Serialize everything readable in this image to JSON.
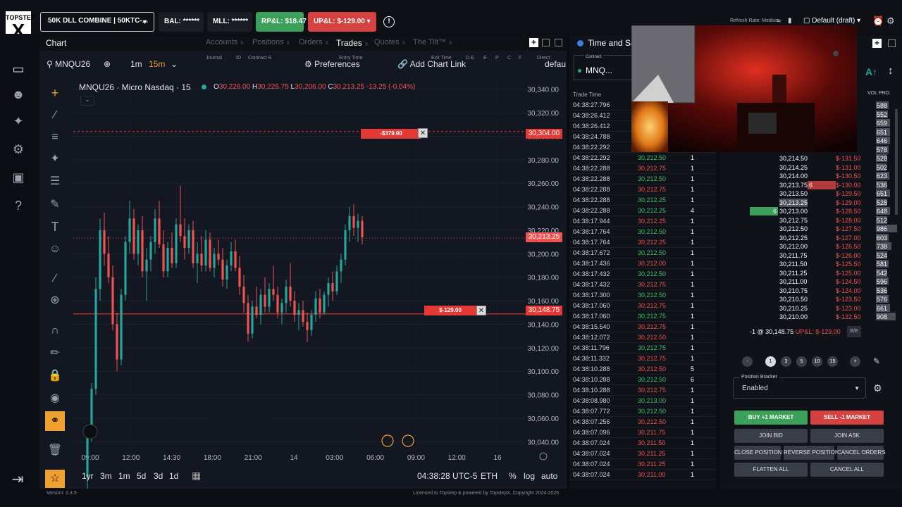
{
  "topbar": {
    "logo_line1": "TOPSTEP",
    "logo_line2": "X",
    "account": "50K DLL COMBINE  |  50KTC-...",
    "bal": "BAL: ******",
    "mll": "MLL: ******",
    "rpl": "RP&L: $18.47",
    "upl": "UP&L: $-129.00",
    "refresh": "Refresh Rate: Medium",
    "layout": "Default (draft)"
  },
  "panel_tabs": {
    "chart": "Chart",
    "accounts": "Accounts",
    "positions": "Positions",
    "orders": "Orders",
    "trades": "Trades",
    "quotes": "Quotes",
    "tilt": "The Tilt™"
  },
  "trades_headers": [
    "Journal",
    "ID",
    "Contract S",
    "Entry Time",
    "Exit Time",
    "D.E.",
    "E",
    "P",
    "C",
    "F",
    "Direct"
  ],
  "chart_toolbar": {
    "symbol": "MNQU26",
    "interval1": "1m",
    "interval2": "15m",
    "preferences": "Preferences",
    "add_link": "Add Chart Link",
    "default": "defau"
  },
  "chart_header": {
    "title": "MNQU26 · Micro Nasdaq · 15",
    "o": "30,226.00",
    "h": "30,226.75",
    "l": "30,206.00",
    "c": "30,213.25",
    "chg": "-13.25 (-0.04%)"
  },
  "chart_footer": {
    "ranges": [
      "1yr",
      "3m",
      "1m",
      "5d",
      "3d",
      "1d"
    ],
    "clock": "04:38:28 UTC-5",
    "session": "ETH",
    "pct": "%",
    "log": "log",
    "auto": "auto"
  },
  "orders_on_chart": {
    "upper_label": "-$379.00",
    "upper_price": "30,304.00",
    "lower_label": "$-129.00",
    "lower_price": "30,148.75",
    "last_price": "30,213.25"
  },
  "chart_data": {
    "type": "candlestick",
    "title": "MNQU26 · Micro Nasdaq · 15",
    "y_ticks": [
      30340,
      30320,
      30300,
      30280,
      30260,
      30240,
      30220,
      30200,
      30180,
      30160,
      30140,
      30120,
      30100,
      30080,
      30060,
      30040
    ],
    "y_tick_labels": [
      "30,340.00",
      "30,320.00",
      "30,300.00",
      "30,280.00",
      "30,260.00",
      "30,240.00",
      "30,220.00",
      "30,200.00",
      "30,180.00",
      "30,160.00",
      "30,140.00",
      "30,120.00",
      "30,100.00",
      "30,080.00",
      "30,060.00",
      "30,040.00"
    ],
    "ylim": [
      30030,
      30350
    ],
    "x_ticks": [
      "09:00",
      "12:00",
      "14:30",
      "18:00",
      "21:00",
      "14",
      "03:00",
      "06:00",
      "09:00",
      "12:00",
      "16"
    ],
    "candles": [
      [
        30010,
        30050,
        30000,
        30045
      ],
      [
        30045,
        30090,
        30040,
        30085
      ],
      [
        30085,
        30180,
        30080,
        30170
      ],
      [
        30170,
        30230,
        30160,
        30220
      ],
      [
        30220,
        30235,
        30190,
        30200
      ],
      [
        30200,
        30215,
        30175,
        30180
      ],
      [
        30180,
        30190,
        30135,
        30140
      ],
      [
        30140,
        30150,
        30100,
        30110
      ],
      [
        30110,
        30170,
        30105,
        30165
      ],
      [
        30165,
        30215,
        30160,
        30210
      ],
      [
        30210,
        30245,
        30200,
        30230
      ],
      [
        30230,
        30238,
        30195,
        30200
      ],
      [
        30200,
        30225,
        30190,
        30220
      ],
      [
        30220,
        30232,
        30180,
        30185
      ],
      [
        30185,
        30205,
        30160,
        30195
      ],
      [
        30195,
        30215,
        30185,
        30210
      ],
      [
        30210,
        30238,
        30200,
        30230
      ],
      [
        30230,
        30245,
        30205,
        30208
      ],
      [
        30208,
        30220,
        30180,
        30185
      ],
      [
        30185,
        30210,
        30180,
        30205
      ],
      [
        30205,
        30218,
        30188,
        30192
      ],
      [
        30192,
        30230,
        30188,
        30225
      ],
      [
        30225,
        30258,
        30210,
        30215
      ],
      [
        30215,
        30230,
        30195,
        30205
      ],
      [
        30205,
        30225,
        30200,
        30220
      ],
      [
        30220,
        30228,
        30188,
        30192
      ],
      [
        30192,
        30210,
        30175,
        30200
      ],
      [
        30200,
        30215,
        30185,
        30190
      ],
      [
        30190,
        30220,
        30185,
        30212
      ],
      [
        30212,
        30218,
        30185,
        30188
      ],
      [
        30188,
        30205,
        30180,
        30200
      ],
      [
        30200,
        30212,
        30190,
        30195
      ],
      [
        30195,
        30205,
        30172,
        30178
      ],
      [
        30178,
        30195,
        30170,
        30190
      ],
      [
        30190,
        30210,
        30185,
        30202
      ],
      [
        30202,
        30212,
        30185,
        30188
      ],
      [
        30188,
        30198,
        30165,
        30172
      ],
      [
        30172,
        30182,
        30150,
        30158
      ],
      [
        30158,
        30165,
        30125,
        30132
      ],
      [
        30132,
        30160,
        30128,
        30155
      ],
      [
        30155,
        30172,
        30145,
        30148
      ],
      [
        30148,
        30170,
        30140,
        30165
      ],
      [
        30165,
        30180,
        30150,
        30155
      ],
      [
        30155,
        30175,
        30150,
        30170
      ],
      [
        30170,
        30190,
        30160,
        30165
      ],
      [
        30165,
        30172,
        30145,
        30150
      ],
      [
        30150,
        30162,
        30140,
        30158
      ],
      [
        30158,
        30178,
        30150,
        30172
      ],
      [
        30172,
        30192,
        30155,
        30160
      ],
      [
        30160,
        30168,
        30142,
        30148
      ],
      [
        30148,
        30158,
        30135,
        30152
      ],
      [
        30152,
        30160,
        30138,
        30142
      ],
      [
        30142,
        30150,
        30125,
        30135
      ],
      [
        30135,
        30152,
        30130,
        30148
      ],
      [
        30148,
        30168,
        30142,
        30162
      ],
      [
        30162,
        30170,
        30145,
        30150
      ],
      [
        30150,
        30168,
        30148,
        30165
      ],
      [
        30165,
        30180,
        30155,
        30175
      ],
      [
        30175,
        30185,
        30160,
        30168
      ],
      [
        30168,
        30190,
        30165,
        30185
      ],
      [
        30185,
        30200,
        30175,
        30195
      ],
      [
        30195,
        30225,
        30190,
        30220
      ],
      [
        30220,
        30240,
        30210,
        30232
      ],
      [
        30232,
        30242,
        30215,
        30222
      ],
      [
        30222,
        30234,
        30210,
        30228
      ],
      [
        30228,
        30232,
        30208,
        30214
      ]
    ]
  },
  "time_sales": {
    "title": "Time and Sales",
    "contract_label": "Contract",
    "contract": "MNQ...",
    "header": "Trade Time",
    "rows": [
      [
        "04:38:27.796",
        "",
        "",
        ""
      ],
      [
        "04:38:26.412",
        "",
        "",
        ""
      ],
      [
        "04:38:26.412",
        "",
        "",
        ""
      ],
      [
        "04:38:24.788",
        "",
        "",
        ""
      ],
      [
        "04:38:22.292",
        "",
        "",
        ""
      ],
      [
        "04:38:22.292",
        "30,212.50",
        "g",
        "1"
      ],
      [
        "04:38:22.288",
        "30,212.75",
        "r",
        "1"
      ],
      [
        "04:38:22.288",
        "30,212.50",
        "g",
        "1"
      ],
      [
        "04:38:22.288",
        "30,212.75",
        "r",
        "1"
      ],
      [
        "04:38:22.288",
        "30,212.25",
        "g",
        "1"
      ],
      [
        "04:38:22.288",
        "30,212.25",
        "g",
        "4"
      ],
      [
        "04:38:17.944",
        "30,212.25",
        "r",
        "1"
      ],
      [
        "04:38:17.764",
        "30,212.50",
        "g",
        "1"
      ],
      [
        "04:38:17.764",
        "30,212.25",
        "r",
        "1"
      ],
      [
        "04:38:17.672",
        "30,212.50",
        "g",
        "1"
      ],
      [
        "04:38:17.436",
        "30,212.00",
        "r",
        "1"
      ],
      [
        "04:38:17.432",
        "30,212.50",
        "g",
        "1"
      ],
      [
        "04:38:17.432",
        "30,212.75",
        "r",
        "1"
      ],
      [
        "04:38:17.300",
        "30,212.50",
        "g",
        "1"
      ],
      [
        "04:38:17.060",
        "30,212.75",
        "r",
        "1"
      ],
      [
        "04:38:17.060",
        "30,212.75",
        "g",
        "1"
      ],
      [
        "04:38:15.540",
        "30,212.75",
        "r",
        "1"
      ],
      [
        "04:38:12.072",
        "30,212.50",
        "r",
        "1"
      ],
      [
        "04:38:11.796",
        "30,212.75",
        "g",
        "1"
      ],
      [
        "04:38:11.332",
        "30,212.75",
        "r",
        "1"
      ],
      [
        "04:38:10.288",
        "30,212.50",
        "r",
        "5"
      ],
      [
        "04:38:10.288",
        "30,212.50",
        "g",
        "6"
      ],
      [
        "04:38:10.288",
        "30,212.75",
        "r",
        "1"
      ],
      [
        "04:38:08.980",
        "30,213.00",
        "g",
        "1"
      ],
      [
        "04:38:07.772",
        "30,212.50",
        "g",
        "1"
      ],
      [
        "04:38:07.256",
        "30,212.50",
        "r",
        "1"
      ],
      [
        "04:38:07.096",
        "30,211.75",
        "r",
        "1"
      ],
      [
        "04:38:07.024",
        "30,211.50",
        "r",
        "1"
      ],
      [
        "04:38:07.024",
        "30,211.25",
        "r",
        "1"
      ],
      [
        "04:38:07.024",
        "30,211.25",
        "r",
        "1"
      ],
      [
        "04:38:07.024",
        "30,211.00",
        "r",
        "1"
      ]
    ]
  },
  "dom": {
    "vol_header": "VOL PRO.",
    "top_rows": [
      [
        "",
        "",
        "588"
      ],
      [
        "",
        "",
        "552"
      ],
      [
        "",
        "",
        "659"
      ],
      [
        "",
        "",
        "651"
      ],
      [
        "",
        "",
        "646"
      ],
      [
        "",
        "",
        "578"
      ]
    ],
    "rows": [
      [
        "30,214.50",
        "$-131.50",
        "528"
      ],
      [
        "30,214.25",
        "$-131.00",
        "502"
      ],
      [
        "30,214.00",
        "$-130.50",
        "623"
      ],
      [
        "30,213.75",
        "$-130.00",
        "536"
      ],
      [
        "30,213.50",
        "$-129.50",
        "651"
      ],
      [
        "30,213.25",
        "$-129.00",
        "528"
      ],
      [
        "30,213.00",
        "$-128.50",
        "648"
      ],
      [
        "30,212.75",
        "$-128.00",
        "512"
      ],
      [
        "30,212.50",
        "$-127.50",
        "986"
      ],
      [
        "30,212.25",
        "$-127.00",
        "603"
      ],
      [
        "30,212.00",
        "$-126.50",
        "738"
      ],
      [
        "30,211.75",
        "$-126.00",
        "524"
      ],
      [
        "30,211.50",
        "$-125.50",
        "581"
      ],
      [
        "30,211.25",
        "$-125.00",
        "542"
      ],
      [
        "30,211.00",
        "$-124.50",
        "596"
      ],
      [
        "30,210.75",
        "$-124.00",
        "536"
      ],
      [
        "30,210.50",
        "$-123.50",
        "576"
      ],
      [
        "30,210.25",
        "$-123.00",
        "661"
      ],
      [
        "30,210.00",
        "$-122.50",
        "908"
      ]
    ],
    "ask_size": "6",
    "bid_size": "6",
    "position_qty": "-1 @ 30,148.75",
    "position_pnl": "UP&L: $-129.00",
    "be": "B/E",
    "qtys": [
      "-",
      "1",
      "3",
      "5",
      "10",
      "15",
      "+"
    ],
    "bracket_label": "Position Bracket",
    "bracket_value": "Enabled",
    "buy": "BUY +1 MARKET",
    "sell": "SELL -1 MARKET",
    "join_bid": "JOIN BID",
    "join_ask": "JOIN ASK",
    "close_pos": "CLOSE POSITION",
    "reverse_pos": "REVERSE POSITION",
    "cancel_orders": "CANCEL ORDERS",
    "flatten": "FLATTEN ALL",
    "cancel_all": "CANCEL ALL"
  },
  "footer": {
    "version": "Version: 2.4.5",
    "license": "Licensed to Topstep & powered by TopstepX. Copyright 2024-2026"
  },
  "colors": {
    "up": "#26a69a",
    "down": "#ef5350",
    "buy": "#3aa05a",
    "sell": "#d6423f",
    "accent": "#f0a030"
  }
}
